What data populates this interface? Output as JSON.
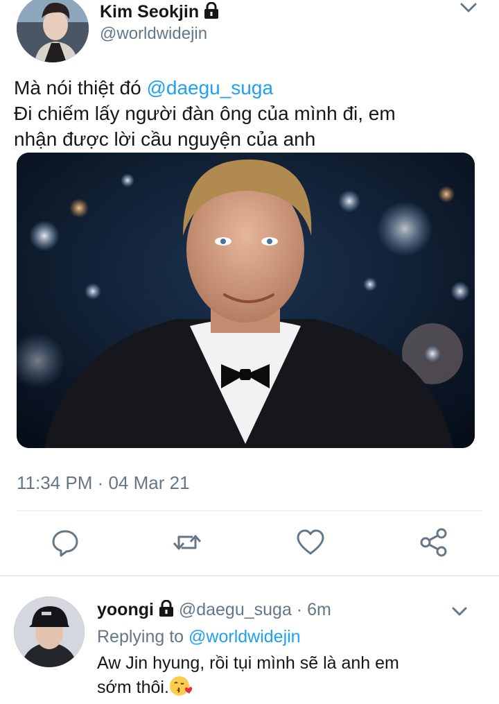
{
  "tweet": {
    "author": {
      "name": "Kim Seokjin",
      "handle": "@worldwidejin",
      "protected_icon": "lock-icon"
    },
    "text": {
      "line1_prefix": "Mà nói thiệt đó",
      "mention": "@daegu_suga",
      "line2": "Đi chiếm lấy người đàn ông của mình đi, em",
      "line3": "nhận được lời cầu nguyện của anh"
    },
    "timestamp": "11:34 PM · 04 Mar 21",
    "actions": [
      "reply-icon",
      "retweet-icon",
      "like-icon",
      "share-icon"
    ]
  },
  "reply": {
    "author_name": "yoongi",
    "author_handle": "@daegu_suga",
    "time_separator": " · ",
    "time": "6m",
    "replying_to_label": "Replying to",
    "replying_to_handle": "@worldwidejin",
    "text_line1": "Aw Jin hyung, rồi tụi mình sẽ là anh em",
    "text_line2": "sớm thôi.",
    "emoji": "kissing-face-emoji"
  },
  "colors": {
    "link": "#1da1f2",
    "secondary_text": "#657786",
    "primary_text": "#14171a",
    "divider": "#e1e8ed"
  }
}
